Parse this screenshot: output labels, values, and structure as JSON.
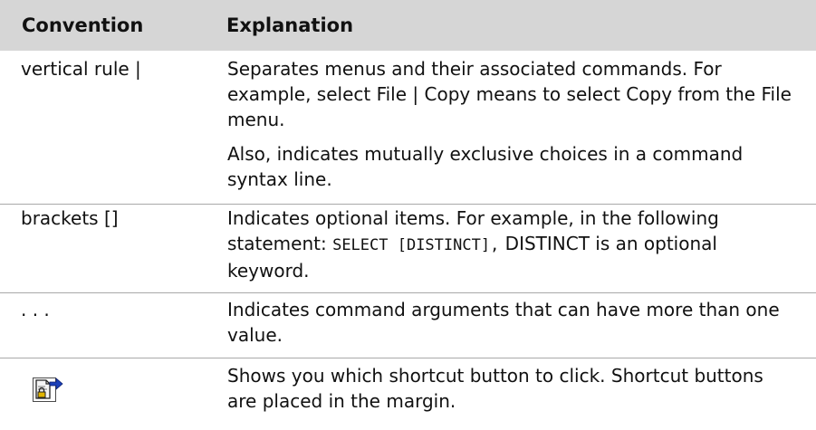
{
  "header": {
    "convention": "Convention",
    "explanation": "Explanation"
  },
  "rows": [
    {
      "convention": "vertical rule |",
      "explanation_p1": "Separates menus and their associated commands. For example, select File | Copy means to select Copy from the File menu.",
      "explanation_p2": "Also, indicates mutually exclusive choices in a command syntax line."
    },
    {
      "convention": "brackets []",
      "explanation_pre": "Indicates optional items. For example, in the following statement:",
      "explanation_code": "SELECT [DISTINCT],",
      "explanation_post": "DISTINCT is an optional keyword."
    },
    {
      "convention": ". . .",
      "explanation": "Indicates command arguments that can have more than one value."
    },
    {
      "convention_icon": "shortcut-button-icon",
      "explanation": "Shows you which shortcut button to click. Shortcut buttons are placed in the margin."
    }
  ]
}
